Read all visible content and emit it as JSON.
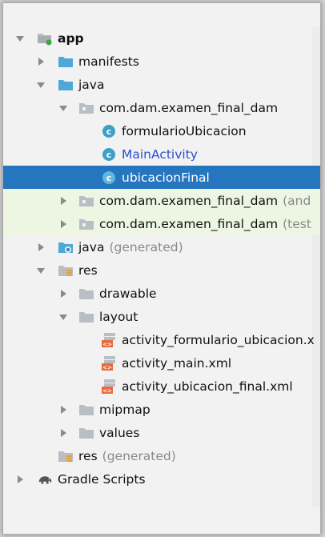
{
  "project_tree": {
    "app": "app",
    "manifests": "manifests",
    "java": "java",
    "package_main": "com.dam.examen_final_dam",
    "class_formulario": "formularioUbicacion",
    "class_main": "MainActivity",
    "class_ubicacion": "ubicacionFinal",
    "package_android_test": "com.dam.examen_final_dam",
    "package_android_test_suffix": "(and",
    "package_test": "com.dam.examen_final_dam",
    "package_test_suffix": "(test",
    "java_generated": "java",
    "java_generated_suffix": "(generated)",
    "res": "res",
    "drawable": "drawable",
    "layout": "layout",
    "layout_file_1": "activity_formulario_ubicacion.x",
    "layout_file_2": "activity_main.xml",
    "layout_file_3": "activity_ubicacion_final.xml",
    "mipmap": "mipmap",
    "values": "values",
    "res_generated": "res",
    "res_generated_suffix": "(generated)",
    "gradle_scripts": "Gradle Scripts"
  },
  "icons": {
    "module": "app-module-icon",
    "folder": "folder-icon",
    "package": "package-icon",
    "class": "class-icon",
    "xml": "xml-layout-icon",
    "gradle": "gradle-elephant-icon"
  },
  "colors": {
    "selection": "#2675bf",
    "folder_blue": "#4fa8d8",
    "package_gray": "#b9bec4",
    "class_cyan": "#3ea0c8",
    "link_blue": "#2a4fd0",
    "test_tint": "#edf5e3"
  }
}
